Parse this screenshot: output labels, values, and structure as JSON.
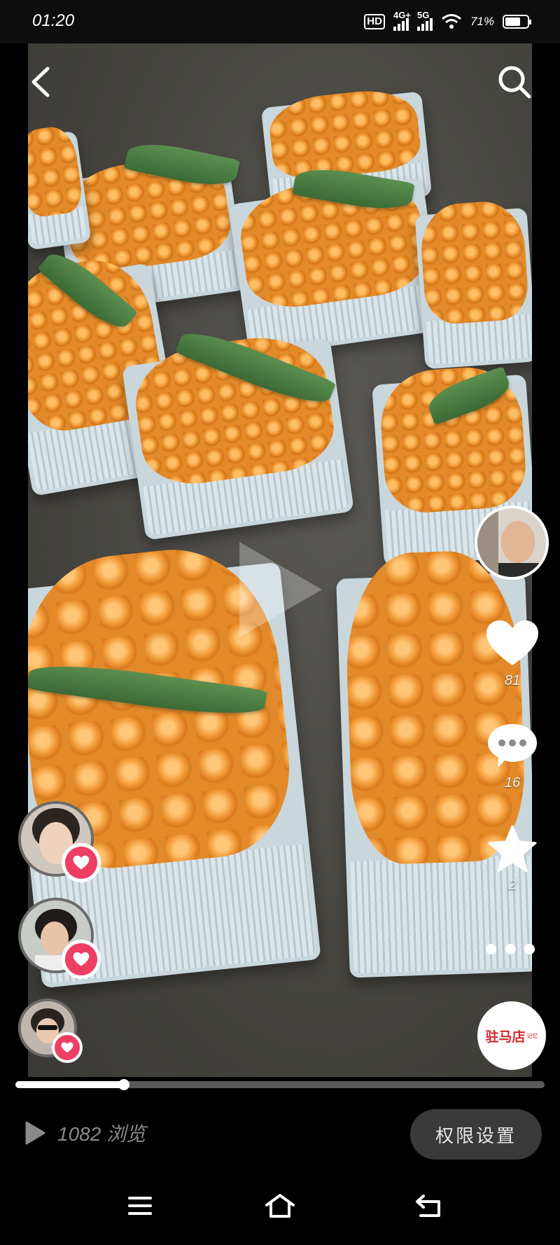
{
  "status_bar": {
    "time": "01:20",
    "hd_label": "HD",
    "signal_1_label": "4G+",
    "signal_2_label": "5G",
    "battery_text": "71%",
    "battery_level": 0.71
  },
  "video": {
    "icons": {
      "back": "chevron-left-icon",
      "search": "search-icon",
      "play": "play-icon"
    }
  },
  "right_rail": {
    "likes": "81",
    "comments": "16",
    "favorites": "2",
    "shop_badge_text": "驻马店",
    "shop_badge_sub": "记忆",
    "icons": {
      "like": "heart-icon",
      "comment": "comment-bubble-icon",
      "favorite": "star-icon",
      "more": "more-dots-icon"
    }
  },
  "likers": [
    {
      "avatar": "liker-avatar-1"
    },
    {
      "avatar": "liker-avatar-2"
    },
    {
      "avatar": "liker-avatar-3"
    }
  ],
  "progress": {
    "fraction": 0.205
  },
  "bottom": {
    "views_text": "1082 浏览",
    "permission_button": "权限设置"
  },
  "nav_bar": {
    "icons": {
      "menu": "menu-icon",
      "home": "home-icon",
      "back": "back-arrow-icon"
    }
  },
  "colors": {
    "accent_pink": "#ee3e63",
    "badge_red": "#d3262b",
    "background": "#000000"
  }
}
